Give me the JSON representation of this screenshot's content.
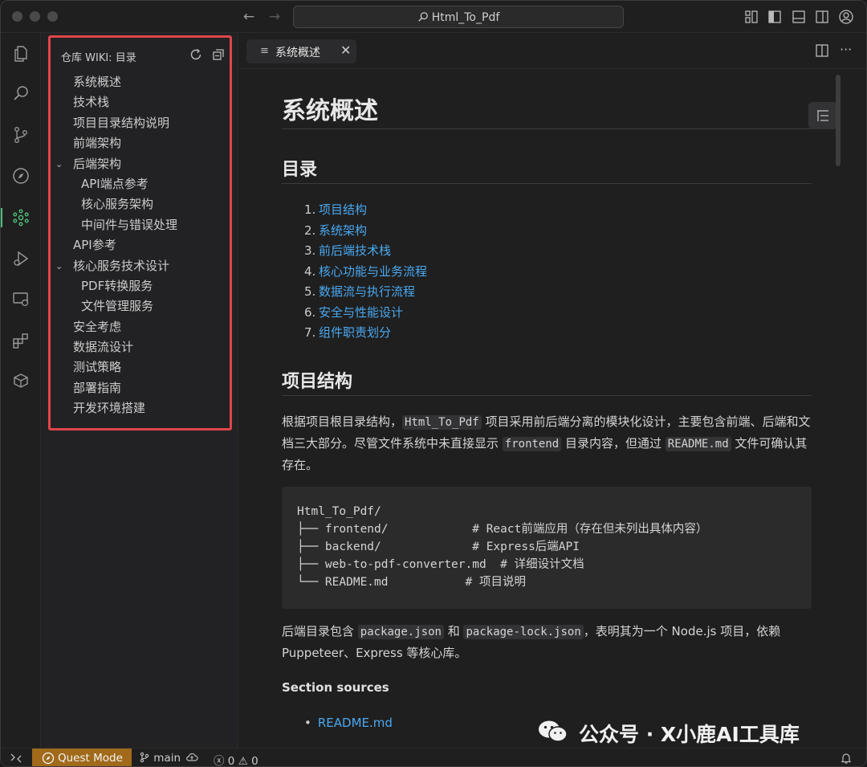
{
  "window": {
    "search_title": "Html_To_Pdf"
  },
  "sidebar": {
    "title": "仓库 WIKI: 目录",
    "items": [
      {
        "label": "系统概述",
        "level": 0
      },
      {
        "label": "技术栈",
        "level": 0
      },
      {
        "label": "项目目录结构说明",
        "level": 0
      },
      {
        "label": "前端架构",
        "level": 0
      },
      {
        "label": "后端架构",
        "level": 0,
        "expanded": true
      },
      {
        "label": "API端点参考",
        "level": 1
      },
      {
        "label": "核心服务架构",
        "level": 1
      },
      {
        "label": "中间件与错误处理",
        "level": 1
      },
      {
        "label": "API参考",
        "level": 0
      },
      {
        "label": "核心服务技术设计",
        "level": 0,
        "expanded": true
      },
      {
        "label": "PDF转换服务",
        "level": 1
      },
      {
        "label": "文件管理服务",
        "level": 1
      },
      {
        "label": "安全考虑",
        "level": 0
      },
      {
        "label": "数据流设计",
        "level": 0
      },
      {
        "label": "测试策略",
        "level": 0
      },
      {
        "label": "部署指南",
        "level": 0
      },
      {
        "label": "开发环境搭建",
        "level": 0
      }
    ]
  },
  "editor": {
    "tab_label": "系统概述",
    "h1": "系统概述",
    "toc_heading": "目录",
    "toc": [
      {
        "num": "1.",
        "label": "项目结构"
      },
      {
        "num": "2.",
        "label": "系统架构"
      },
      {
        "num": "3.",
        "label": "前后端技术栈"
      },
      {
        "num": "4.",
        "label": "核心功能与业务流程"
      },
      {
        "num": "5.",
        "label": "数据流与执行流程"
      },
      {
        "num": "6.",
        "label": "安全与性能设计"
      },
      {
        "num": "7.",
        "label": "组件职责划分"
      }
    ],
    "section_heading": "项目结构",
    "para1": {
      "a": "根据项目根目录结构，",
      "code1": "Html_To_Pdf",
      "b": " 项目采用前后端分离的模块化设计，主要包含前端、后端和文档三大部分。尽管文件系统中未直接显示 ",
      "code2": "frontend",
      "c": " 目录内容，但通过 ",
      "code3": "README.md",
      "d": " 文件可确认其存在。"
    },
    "code_block": "Html_To_Pdf/\n├── frontend/            # React前端应用（存在但未列出具体内容）\n├── backend/             # Express后端API\n├── web-to-pdf-converter.md  # 详细设计文档\n└── README.md           # 项目说明",
    "para2": {
      "a": "后端目录包含 ",
      "code1": "package.json",
      "b": " 和 ",
      "code2": "package-lock.json",
      "c": "，表明其为一个 Node.js 项目，依赖 Puppeteer、Express 等核心库。"
    },
    "sources_heading": "Section sources",
    "sources": [
      "README.md"
    ]
  },
  "watermark": "公众号 · X小鹿AI工具库",
  "statusbar": {
    "quest_mode": "Quest Mode",
    "branch": "main",
    "errors": "0",
    "warnings": "0"
  },
  "colors": {
    "accent_green": "#4ec07a",
    "link_blue": "#4aa8f0",
    "highlight_red": "#e0454a",
    "quest_bg": "#a06a1a"
  }
}
